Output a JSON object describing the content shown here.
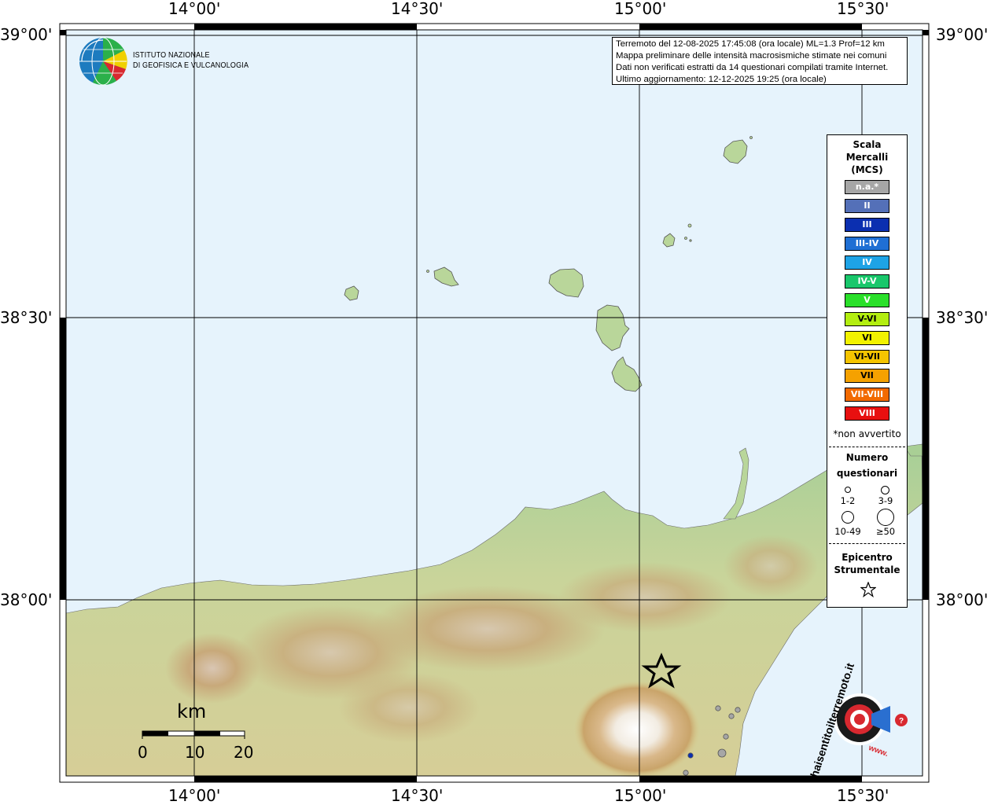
{
  "coordinates": {
    "top": [
      "14°00'",
      "14°30'",
      "15°00'",
      "15°30'"
    ],
    "bottom": [
      "14°00'",
      "14°30'",
      "15°00'",
      "15°30'"
    ],
    "left": [
      "39°00'",
      "38°30'",
      "38°00'"
    ],
    "right": [
      "39°00'",
      "38°30'",
      "38°00'"
    ]
  },
  "info_box": [
    "Terremoto del 12-08-2025 17:45:08 (ora locale) ML=1.3 Prof=12 km",
    "Mappa preliminare delle intensità macrosismiche stimate nei comuni",
    "Dati non verificati estratti da 14 questionari compilati tramite Internet.",
    "Ultimo aggiornamento: 12-12-2025 19:25 (ora locale)"
  ],
  "ingv": {
    "line1": "ISTITUTO NAZIONALE",
    "line2": "DI GEOFISICA E VULCANOLOGIA"
  },
  "legend": {
    "title": [
      "Scala",
      "Mercalli",
      "(MCS)"
    ],
    "intensity": [
      {
        "label": "n.a.*",
        "color": "#a6a6a6"
      },
      {
        "label": "II",
        "color": "#5470b8"
      },
      {
        "label": "III",
        "color": "#0b2fb0"
      },
      {
        "label": "III-IV",
        "color": "#1f6fd4"
      },
      {
        "label": "IV",
        "color": "#1ea3e6"
      },
      {
        "label": "IV-V",
        "color": "#19c76b"
      },
      {
        "label": "V",
        "color": "#2ae02a"
      },
      {
        "label": "V-VI",
        "color": "#b3ee10"
      },
      {
        "label": "VI",
        "color": "#f2f200"
      },
      {
        "label": "VI-VII",
        "color": "#f5c400"
      },
      {
        "label": "VII",
        "color": "#f5a100"
      },
      {
        "label": "VII-VIII",
        "color": "#f26a00"
      },
      {
        "label": "VIII",
        "color": "#e81010"
      }
    ],
    "non_avvertito": "*non avvertito",
    "questionari_title": [
      "Numero",
      "questionari"
    ],
    "circles": [
      "1-2",
      "3-9",
      "10-49",
      "≥50"
    ],
    "epicentro_title": [
      "Epicentro",
      "Strumentale"
    ]
  },
  "scale_bar": {
    "unit": "km",
    "ticks": [
      "0",
      "10",
      "20"
    ]
  },
  "site_logo": {
    "text": "haisentitoilterremoto.it",
    "www": "www."
  },
  "colors": {
    "sea": "#e6f3fc",
    "grid": "#000000",
    "frame_dark": "#000000",
    "epicentre": "#000000"
  },
  "map_features": {
    "epicentre_icon": "star-icon",
    "intensity_points": [
      {
        "intensity": "n.a.*",
        "size": "1-2"
      },
      {
        "intensity": "n.a.*",
        "size": "1-2"
      },
      {
        "intensity": "n.a.*",
        "size": "1-2"
      },
      {
        "intensity": "n.a.*",
        "size": "1-2"
      },
      {
        "intensity": "n.a.*",
        "size": "3-9"
      },
      {
        "intensity": "III",
        "size": "1-2"
      },
      {
        "intensity": "n.a.*",
        "size": "1-2"
      }
    ]
  }
}
